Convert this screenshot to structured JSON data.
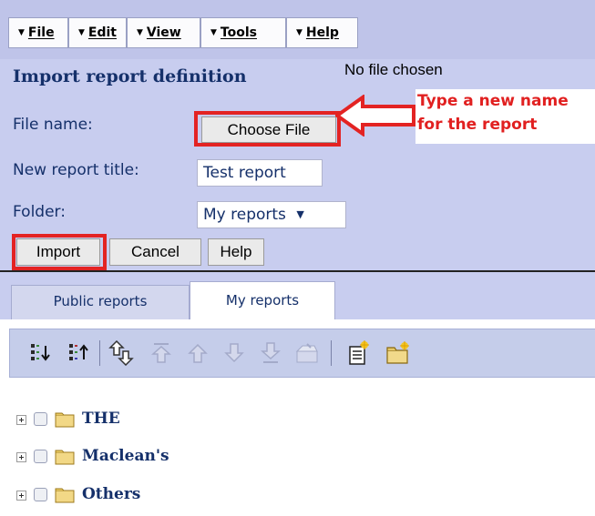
{
  "menu": {
    "items": [
      {
        "label": "File"
      },
      {
        "label": "Edit"
      },
      {
        "label": "View"
      },
      {
        "label": "Tools"
      },
      {
        "label": "Help"
      }
    ]
  },
  "import_dialog": {
    "title": "Import report definition",
    "file_name_label": "File name:",
    "choose_file_button": "Choose File",
    "no_file_text": "No file chosen",
    "new_title_label": "New report title:",
    "new_title_value": "Test report",
    "folder_label": "Folder:",
    "folder_value": "My reports",
    "import_button": "Import",
    "cancel_button": "Cancel",
    "help_button": "Help"
  },
  "annotation": {
    "line1": "Type a new name",
    "line2": "for the report",
    "color": "#e12020"
  },
  "tabs": [
    {
      "label": "Public reports",
      "active": false
    },
    {
      "label": "My reports",
      "active": true
    }
  ],
  "toolbar": {
    "icons": [
      "expand-all-icon",
      "collapse-all-icon",
      "move-icon",
      "move-top-icon",
      "move-up-icon",
      "move-down-icon",
      "move-bottom-icon",
      "paste-icon",
      "new-report-icon",
      "new-folder-icon"
    ]
  },
  "tree": {
    "folders": [
      {
        "label": "THE"
      },
      {
        "label": "Maclean's"
      },
      {
        "label": "Others"
      }
    ]
  },
  "colors": {
    "menu_background": "#bfc4e9",
    "panel_background": "#c8cdef",
    "text_navy": "#15306a",
    "highlight_red": "#e32323"
  }
}
